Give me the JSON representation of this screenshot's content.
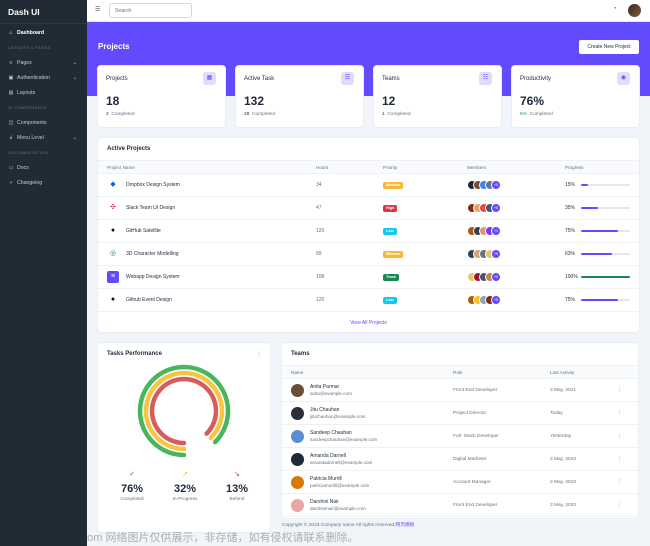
{
  "app": {
    "name": "Dash UI"
  },
  "sidebar": {
    "items": [
      {
        "type": "item",
        "label": "Dashboard",
        "icon": "home-icon",
        "active": true
      },
      {
        "type": "header",
        "label": "LAYOUTS & PAGES"
      },
      {
        "type": "item",
        "label": "Pages",
        "icon": "layers-icon",
        "chevron": true
      },
      {
        "type": "item",
        "label": "Authentication",
        "icon": "lock-icon",
        "chevron": true
      },
      {
        "type": "item",
        "label": "Layouts",
        "icon": "sidebar-icon"
      },
      {
        "type": "header",
        "label": "UI COMPONENTS"
      },
      {
        "type": "item",
        "label": "Components",
        "icon": "package-icon"
      },
      {
        "type": "item",
        "label": "Menu Level",
        "icon": "corner-left-down-icon",
        "chevron": true
      },
      {
        "type": "header",
        "label": "DOCUMENTATION"
      },
      {
        "type": "item",
        "label": "Docs",
        "icon": "clipboard-icon"
      },
      {
        "type": "item",
        "label": "Changelog",
        "icon": "git-pull-request-icon"
      }
    ]
  },
  "topbar": {
    "search_placeholder": "Search"
  },
  "header": {
    "title": "Projects",
    "new_button": "Create New Project"
  },
  "stats": [
    {
      "title": "Projects",
      "value": "18",
      "count": "2",
      "suffix": "Completed",
      "icon": "briefcase-icon"
    },
    {
      "title": "Active Task",
      "value": "132",
      "count": "28",
      "suffix": "Completed",
      "icon": "list-icon"
    },
    {
      "title": "Teams",
      "value": "12",
      "count": "1",
      "suffix": "Completed",
      "icon": "people-icon"
    },
    {
      "title": "Productivity",
      "value": "76%",
      "count": "5%",
      "suffix": "Completed",
      "icon": "bullseye-icon"
    }
  ],
  "active_projects": {
    "title": "Active Projects",
    "columns": [
      "Project Name",
      "Hours",
      "Priority",
      "Members",
      "Progress"
    ],
    "view_all": "View All Projects",
    "rows": [
      {
        "name": "Dropbox Design System",
        "hours": "34",
        "priority": "Medium",
        "priority_color": "#f8b738",
        "plus": "+5",
        "progress_label": "15%",
        "progress": 0.15,
        "bar_color": "#624bff",
        "icon": "dropbox-icon"
      },
      {
        "name": "Slack Team UI Design",
        "hours": "47",
        "priority": "High",
        "priority_color": "#dc3545",
        "plus": "+5",
        "progress_label": "35%",
        "progress": 0.35,
        "bar_color": "#624bff",
        "icon": "slack-icon"
      },
      {
        "name": "GitHub Satellite",
        "hours": "120",
        "priority": "Low",
        "priority_color": "#0dcaf0",
        "plus": "+1",
        "progress_label": "75%",
        "progress": 0.75,
        "bar_color": "#624bff",
        "icon": "github-icon"
      },
      {
        "name": "3D Character Modelling",
        "hours": "89",
        "priority": "Medium",
        "priority_color": "#f8b738",
        "plus": "+5",
        "progress_label": "63%",
        "progress": 0.63,
        "bar_color": "#624bff",
        "icon": "openai-icon"
      },
      {
        "name": "Webapp Design System",
        "hours": "108",
        "priority": "Track",
        "priority_color": "#198754",
        "plus": "+5",
        "progress_label": "100%",
        "progress": 1.0,
        "bar_color": "#198754",
        "icon": "layers-icon"
      },
      {
        "name": "Github Event Design",
        "hours": "120",
        "priority": "Low",
        "priority_color": "#0dcaf0",
        "plus": "+5",
        "progress_label": "75%",
        "progress": 0.75,
        "bar_color": "#624bff",
        "icon": "github-icon"
      }
    ]
  },
  "tasks_performance": {
    "title": "Tasks Performance",
    "items": [
      {
        "value": "76%",
        "label": "Completed",
        "icon": "check-circle-icon",
        "color": "#198754"
      },
      {
        "value": "32%",
        "label": "In-Progress",
        "icon": "trending-up-icon",
        "color": "#f8b738"
      },
      {
        "value": "13%",
        "label": "Behind",
        "icon": "trending-down-icon",
        "color": "#dc3545"
      }
    ]
  },
  "teams": {
    "title": "Teams",
    "columns": [
      "Name",
      "Role",
      "Last Activity"
    ],
    "rows": [
      {
        "name": "Anita Parmar",
        "email": "anita@example.com",
        "role": "Front End Developer",
        "last": "3 May, 2021"
      },
      {
        "name": "Jitu Chauhan",
        "email": "jituchauhan@example.com",
        "role": "Project Director",
        "last": "Today"
      },
      {
        "name": "Sandeep Chauhan",
        "email": "sandeepchauhan@example.com",
        "role": "Full- Stack Developer",
        "last": "Yesterday"
      },
      {
        "name": "Amanda Darnell",
        "email": "amandadarnell@example.com",
        "role": "Digital Marketer",
        "last": "3 May, 2023"
      },
      {
        "name": "Patricia Murrill",
        "email": "patriciamurrill@example.com",
        "role": "Account Manager",
        "last": "3 May, 2023"
      },
      {
        "name": "Darshini Nair",
        "email": "darshininair@example.com",
        "role": "Front End Developer",
        "last": "3 May, 2023"
      }
    ]
  },
  "footer": {
    "text": "Copyright © 2023.Company name All rights reserved.",
    "link": "网页模板"
  },
  "watermark": "www.toymoban.com 网络图片仅供展示，非存储，如有侵权请联系删除。"
}
